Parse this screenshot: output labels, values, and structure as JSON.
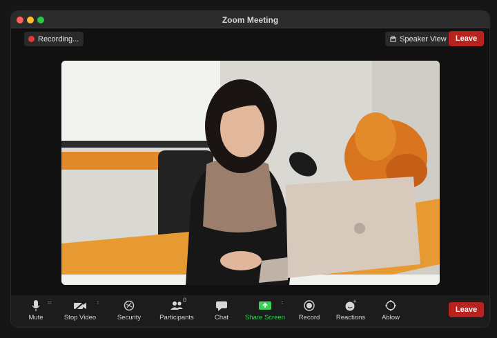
{
  "window": {
    "title": "Zoom Meeting"
  },
  "recording": {
    "label": "Recording...",
    "color": "#e23a3a"
  },
  "view": {
    "speaker_view_label": "Speaker View"
  },
  "leave_label": "Leave",
  "toolbar": {
    "mute": "Mute",
    "stop_video": "Stop Video",
    "security": "Security",
    "participants": "Participants",
    "participants_count": "0",
    "chat": "Chat",
    "share_screen": "Share Screen",
    "record": "Record",
    "reactions": "Reactions",
    "ablow": "Ablow"
  },
  "colors": {
    "leave": "#b8231f",
    "share_green": "#3ccf5a"
  }
}
